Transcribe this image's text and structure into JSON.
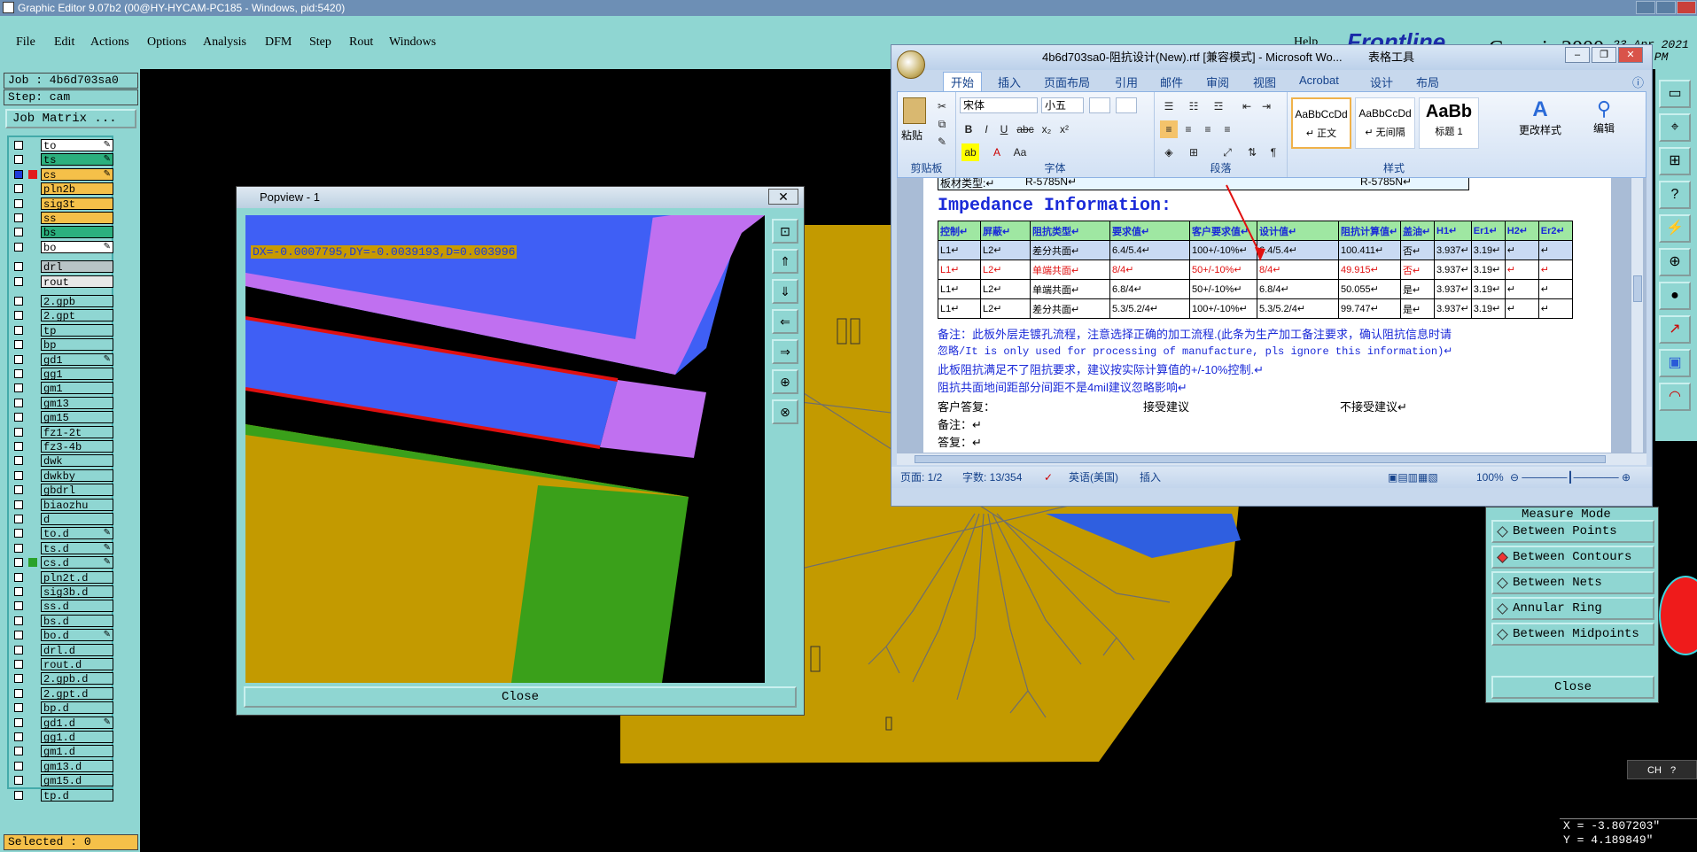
{
  "titlebar": {
    "title": "Graphic Editor 9.07b2 (00@HY-HYCAM-PC185 - Windows, pid:5420)"
  },
  "menu": [
    "File",
    "Edit",
    "Actions",
    "Options",
    "Analysis",
    "DFM",
    "Step",
    "Rout",
    "Windows"
  ],
  "help_label": "Help",
  "brand": {
    "frontline": "Frontline",
    "genesis": "Genesis 2000",
    "date": "23 Apr 2021",
    "time": "01:21 PM"
  },
  "job": {
    "job_line": "Job : 4b6d703sa0",
    "step_line": "Step: cam",
    "matrix_button": "Job Matrix ..."
  },
  "layers": [
    {
      "name": "to",
      "color": "#ffffff",
      "edit": true
    },
    {
      "name": "ts",
      "color": "#2bb07e",
      "edit": true
    },
    {
      "name": "cs",
      "color": "#f5c049",
      "edit": true,
      "active": true
    },
    {
      "name": "pln2b",
      "color": "#f5c049"
    },
    {
      "name": "sig3t",
      "color": "#f5c049"
    },
    {
      "name": "ss",
      "color": "#f5c049"
    },
    {
      "name": "bs",
      "color": "#2bb07e"
    },
    {
      "name": "bo",
      "color": "#ffffff",
      "edit": true
    },
    {
      "name": "drl",
      "color": "#b8c4c6"
    },
    {
      "name": "rout",
      "color": "#e8e8e8"
    },
    {
      "name": "2.gpb",
      "color": "#8fd6d2"
    },
    {
      "name": "2.gpt",
      "color": "#8fd6d2"
    },
    {
      "name": "tp",
      "color": "#8fd6d2"
    },
    {
      "name": "bp",
      "color": "#8fd6d2"
    },
    {
      "name": "gd1",
      "color": "#8fd6d2",
      "edit": true
    },
    {
      "name": "gg1",
      "color": "#8fd6d2"
    },
    {
      "name": "gm1",
      "color": "#8fd6d2"
    },
    {
      "name": "gm13",
      "color": "#8fd6d2"
    },
    {
      "name": "gm15",
      "color": "#8fd6d2"
    },
    {
      "name": "fz1-2t",
      "color": "#8fd6d2"
    },
    {
      "name": "fz3-4b",
      "color": "#8fd6d2"
    },
    {
      "name": "dwk",
      "color": "#8fd6d2"
    },
    {
      "name": "dwkby",
      "color": "#8fd6d2"
    },
    {
      "name": "gbdrl",
      "color": "#8fd6d2"
    },
    {
      "name": "biaozhu",
      "color": "#8fd6d2"
    },
    {
      "name": "d",
      "color": "#8fd6d2"
    },
    {
      "name": "to.d",
      "color": "#8fd6d2",
      "edit": true
    },
    {
      "name": "ts.d",
      "color": "#8fd6d2",
      "edit": true
    },
    {
      "name": "cs.d",
      "color": "#8fd6d2",
      "edit": true,
      "swatch": "#2aa22a"
    },
    {
      "name": "pln2t.d",
      "color": "#8fd6d2"
    },
    {
      "name": "sig3b.d",
      "color": "#8fd6d2"
    },
    {
      "name": "ss.d",
      "color": "#8fd6d2"
    },
    {
      "name": "bs.d",
      "color": "#8fd6d2"
    },
    {
      "name": "bo.d",
      "color": "#8fd6d2",
      "edit": true
    },
    {
      "name": "drl.d",
      "color": "#8fd6d2"
    },
    {
      "name": "rout.d",
      "color": "#8fd6d2"
    },
    {
      "name": "2.gpb.d",
      "color": "#8fd6d2"
    },
    {
      "name": "2.gpt.d",
      "color": "#8fd6d2"
    },
    {
      "name": "bp.d",
      "color": "#8fd6d2"
    },
    {
      "name": "gd1.d",
      "color": "#8fd6d2",
      "edit": true
    },
    {
      "name": "gg1.d",
      "color": "#8fd6d2"
    },
    {
      "name": "gm1.d",
      "color": "#8fd6d2"
    },
    {
      "name": "gm13.d",
      "color": "#8fd6d2"
    },
    {
      "name": "gm15.d",
      "color": "#8fd6d2"
    },
    {
      "name": "tp.d",
      "color": "#8fd6d2"
    }
  ],
  "selected": "Selected : 0",
  "popview": {
    "title": "Popview - 1",
    "readout": "DX=-0.0007795,DY=-0.0039193,D=0.003996",
    "close": "Close"
  },
  "word": {
    "title": "4b6d703sa0-阻抗设计(New).rtf [兼容模式] - Microsoft Wo...",
    "tools_title": "表格工具",
    "tabs": [
      "开始",
      "插入",
      "页面布局",
      "引用",
      "邮件",
      "审阅",
      "视图",
      "Acrobat",
      "设计",
      "布局"
    ],
    "font_name": "宋体",
    "font_size": "小五",
    "groups": [
      "剪贴板",
      "字体",
      "段落",
      "样式"
    ],
    "paste": "粘贴",
    "styles": [
      {
        "sample": "AaBbCcDd",
        "label": "↵ 正文"
      },
      {
        "sample": "AaBbCcDd",
        "label": "↵ 无间隔"
      },
      {
        "sample": "AaBb",
        "label": "标题 1"
      }
    ],
    "change_styles": "更改样式",
    "edit_label": "编辑",
    "doc": {
      "top_row": [
        "板材类型:↵",
        "R-5785N↵",
        "R-5785N↵"
      ],
      "heading": "Impedance Information:",
      "table_header": [
        "控制↵",
        "屏蔽↵",
        "阻抗类型↵",
        "要求值↵",
        "客户要求值↵",
        "设计值↵",
        "阻抗计算值↵",
        "盖油↵",
        "H1↵",
        "Er1↵",
        "H2↵",
        "Er2↵"
      ],
      "rows": [
        [
          "L1↵",
          "L2↵",
          "差分共面↵",
          "6.4/5.4↵",
          "100+/-10%↵",
          "6.4/5.4↵",
          "100.411↵",
          "否↵",
          "3.937↵",
          "3.19↵",
          "↵",
          "↵"
        ],
        [
          "L1↵",
          "L2↵",
          "单端共面↵",
          "8/4↵",
          "50+/-10%↵",
          "8/4↵",
          "49.915↵",
          "否↵",
          "3.937↵",
          "3.19↵",
          "↵",
          "↵"
        ],
        [
          "L1↵",
          "L2↵",
          "单端共面↵",
          "6.8/4↵",
          "50+/-10%↵",
          "6.8/4↵",
          "50.055↵",
          "是↵",
          "3.937↵",
          "3.19↵",
          "↵",
          "↵"
        ],
        [
          "L1↵",
          "L2↵",
          "差分共面↵",
          "5.3/5.2/4↵",
          "100+/-10%↵",
          "5.3/5.2/4↵",
          "99.747↵",
          "是↵",
          "3.937↵",
          "3.19↵",
          "↵",
          "↵"
        ]
      ],
      "note1": "备注：此板外层走镀孔流程，注意选择正确的加工流程.(此条为生产加工备注要求，确认阻抗信息时请",
      "note2": "忽略/It is only used for processing of manufacture, pls ignore this information)↵",
      "note3": "此板阻抗满足不了阻抗要求，建议按实际计算值的+/-10%控制.↵",
      "note4": "阻抗共面地间距部分间距不是4mil建议忽略影响↵",
      "reply_label": "客户答复：",
      "accept": "接受建议",
      "reject": "不接受建议↵",
      "remark": "备注：↵",
      "answer": "答复：↵"
    },
    "status": {
      "page": "页面: 1/2",
      "words": "字数: 13/354",
      "lang": "英语(美国)",
      "mode": "插入",
      "zoom": "100%"
    }
  },
  "measure": {
    "title": "Measure Mode",
    "options": [
      {
        "label": "Between Points",
        "on": false
      },
      {
        "label": "Between Contours",
        "on": true
      },
      {
        "label": "Between Nets",
        "on": false
      },
      {
        "label": "Annular Ring",
        "on": false
      },
      {
        "label": "Between Midpoints",
        "on": false
      }
    ],
    "close": "Close"
  },
  "coords": {
    "x": "X = -3.807203\"",
    "y": "Y = 4.189849\""
  },
  "ime": "CH"
}
